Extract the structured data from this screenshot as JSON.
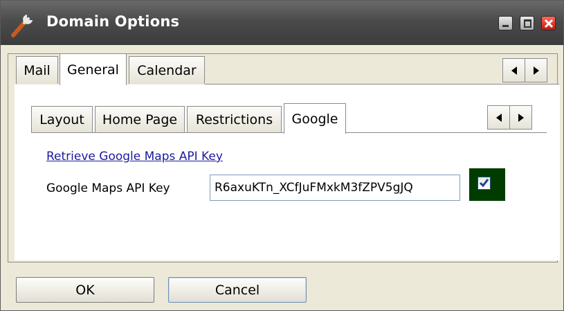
{
  "window": {
    "title": "Domain Options"
  },
  "tabs_outer": [
    {
      "label": "Mail",
      "active": false
    },
    {
      "label": "General",
      "active": true
    },
    {
      "label": "Calendar",
      "active": false
    }
  ],
  "tabs_inner": [
    {
      "label": "Layout",
      "active": false
    },
    {
      "label": "Home Page",
      "active": false
    },
    {
      "label": "Restrictions",
      "active": false
    },
    {
      "label": "Google",
      "active": true
    }
  ],
  "google": {
    "link_text": "Retrieve Google Maps API Key",
    "api_key_label": "Google Maps API Key",
    "api_key_value": "R6axuKTn_XCfJuFMxkM3fZPV5gJQ",
    "enabled_checked": true
  },
  "buttons": {
    "ok": "OK",
    "cancel": "Cancel"
  },
  "colors": {
    "titlebar": "#4b4b4b",
    "link": "#1a1a9e",
    "checkbox_highlight": "#003c00"
  }
}
